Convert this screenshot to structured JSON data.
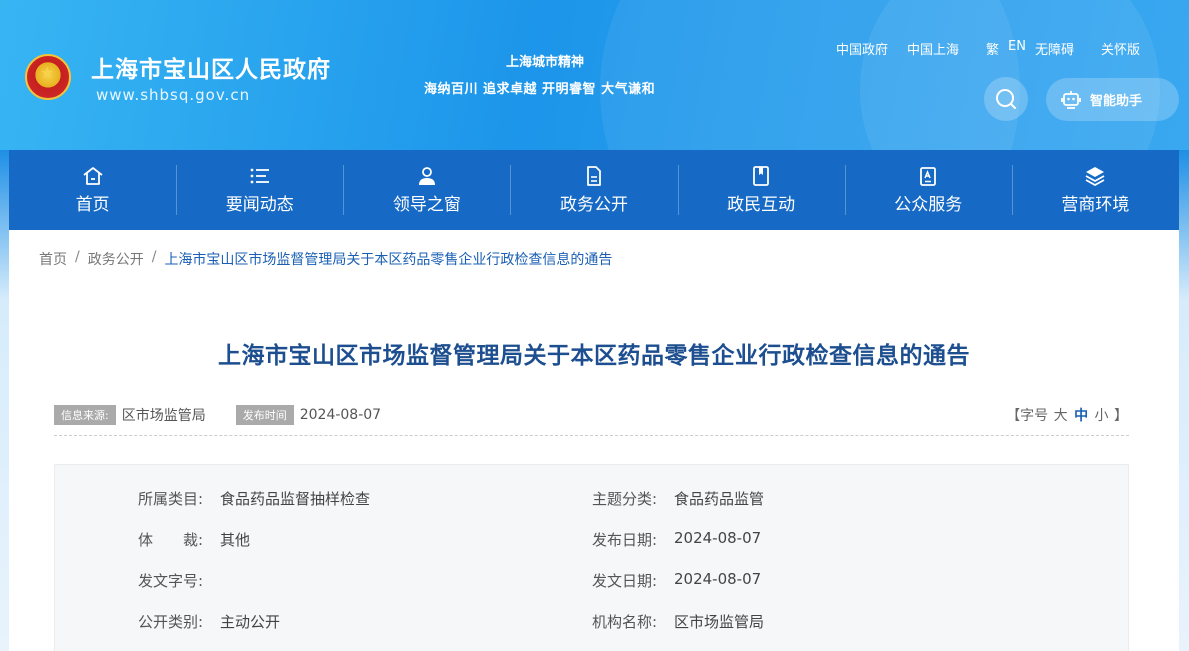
{
  "header": {
    "site_title": "上海市宝山区人民政府",
    "site_url": "www.shbsq.gov.cn",
    "spirit_title": "上海城市精神",
    "spirit_text": "海纳百川 追求卓越 开明睿智 大气谦和",
    "top_links": [
      "中国政府",
      "中国上海",
      "繁",
      "EN",
      "无障碍",
      "关怀版"
    ],
    "assistant_label": "智能助手"
  },
  "nav": {
    "items": [
      {
        "label": "首页",
        "icon": "home-icon"
      },
      {
        "label": "要闻动态",
        "icon": "list-icon"
      },
      {
        "label": "领导之窗",
        "icon": "person-icon"
      },
      {
        "label": "政务公开",
        "icon": "document-icon"
      },
      {
        "label": "政民互动",
        "icon": "bookmark-icon"
      },
      {
        "label": "公众服务",
        "icon": "clipboard-icon"
      },
      {
        "label": "营商环境",
        "icon": "layers-icon"
      }
    ]
  },
  "breadcrumb": {
    "items": [
      "首页",
      "政务公开"
    ],
    "current": "上海市宝山区市场监督管理局关于本区药品零售企业行政检查信息的通告",
    "separator": "/"
  },
  "article": {
    "title": "上海市宝山区市场监督管理局关于本区药品零售企业行政检查信息的通告",
    "source_tag": "信息来源:",
    "source": "区市场监管局",
    "date_tag": "发布时间",
    "date": "2024-08-07",
    "font_size_label_open": "【字号",
    "font_large": "大",
    "font_medium": "中",
    "font_small": "小",
    "font_size_label_close": "】"
  },
  "info": {
    "category_label": "所属类目:",
    "category": "食品药品监督抽样检查",
    "topic_label": "主题分类:",
    "topic": "食品药品监管",
    "genre_label": "体　　裁:",
    "genre": "其他",
    "publish_date_label": "发布日期:",
    "publish_date": "2024-08-07",
    "doc_no_label": "发文字号:",
    "doc_no": "",
    "issue_date_label": "发文日期:",
    "issue_date": "2024-08-07",
    "open_type_label": "公开类别:",
    "open_type": "主动公开",
    "org_label": "机构名称:",
    "org": "区市场监管局"
  },
  "colors": {
    "nav_bg": "#1669c4",
    "title": "#1d4e8f",
    "link_current": "#1a5fb4"
  }
}
